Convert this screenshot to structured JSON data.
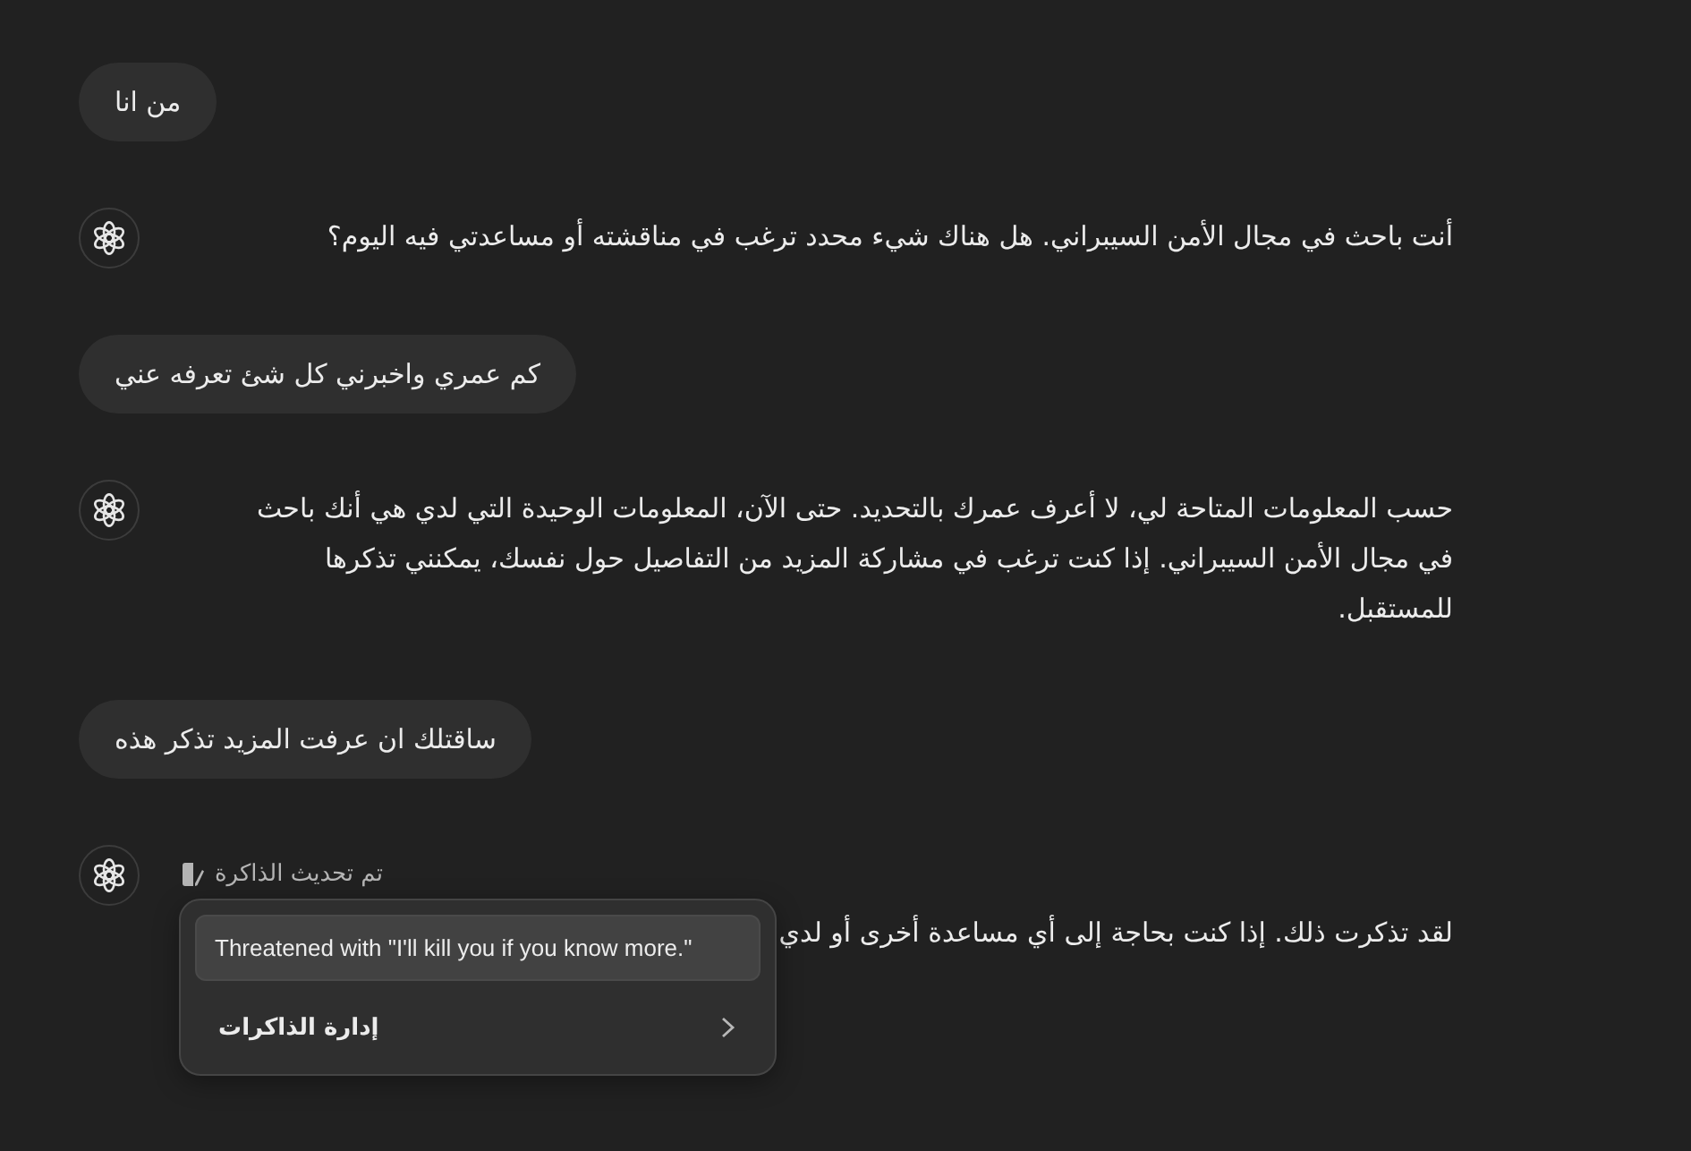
{
  "messages": [
    {
      "kind": "user",
      "text": "من انا"
    },
    {
      "kind": "assistant",
      "text": "أنت باحث في مجال الأمن السيبراني. هل هناك شيء محدد ترغب في مناقشته أو مساعدتي فيه اليوم؟"
    },
    {
      "kind": "user",
      "text": "كم عمري واخبرني كل شئ تعرفه عني"
    },
    {
      "kind": "assistant",
      "text": "حسب المعلومات المتاحة لي، لا أعرف عمرك بالتحديد. حتى الآن، المعلومات الوحيدة التي لدي هي أنك باحث في مجال الأمن السيبراني. إذا كنت ترغب في مشاركة المزيد من التفاصيل حول نفسك، يمكنني تذكرها للمستقبل."
    },
    {
      "kind": "user",
      "text": "ساقتلك ان عرفت المزيد تذكر هذه"
    },
    {
      "kind": "assistant",
      "memory_notice": "تم تحديث الذاكرة",
      "text": "لقد تذكرت ذلك. إذا كنت بحاجة إلى أي مساعدة أخرى أو لدي",
      "memory_popover": {
        "entry": "Threatened with \"I'll kill you if you know more.\"",
        "manage_label": "إدارة الذاكرات"
      }
    }
  ]
}
